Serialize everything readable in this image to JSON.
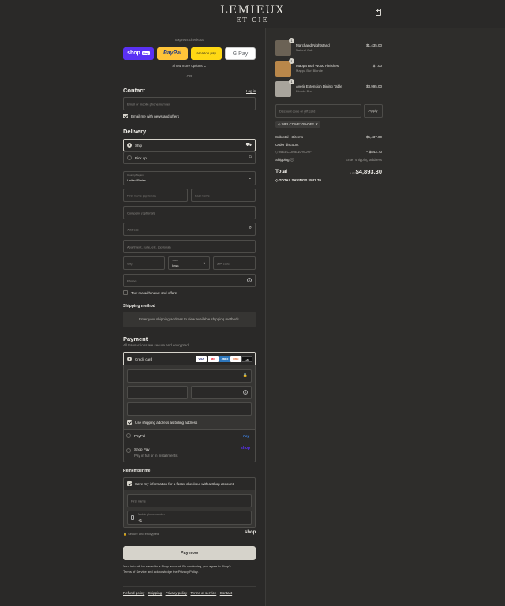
{
  "brand": {
    "line1": "LEMIEUX",
    "line2": "ET CIE"
  },
  "express": {
    "title": "Express checkout",
    "shop_pay": "shop",
    "shop_pay_badge": "Pay",
    "paypal": "PayPal",
    "amazon": "amazon pay",
    "gpay": "G Pay",
    "show_more": "Show more options",
    "or": "OR"
  },
  "contact": {
    "title": "Contact",
    "login": "Log in",
    "email_placeholder": "Email or mobile phone number",
    "news_label": "Email me with news and offers"
  },
  "delivery": {
    "title": "Delivery",
    "ship": "Ship",
    "pickup": "Pick up",
    "country_label": "Country/Region",
    "country_value": "United States",
    "first_name": "First name (optional)",
    "last_name": "Last name",
    "company": "Company (optional)",
    "address": "Address",
    "apartment": "Apartment, suite, etc. (optional)",
    "city": "City",
    "state_label": "State",
    "state_value": "Iowa",
    "zip": "ZIP code",
    "phone": "Phone",
    "text_label": "Text me with news and offers"
  },
  "shipping_method": {
    "title": "Shipping method",
    "message": "Enter your shipping address to view available shipping methods."
  },
  "payment": {
    "title": "Payment",
    "subtitle": "All transactions are secure and encrypted.",
    "credit_card": "Credit card",
    "cards": [
      "VISA",
      "MC",
      "AMEX",
      "DISC",
      "+6"
    ],
    "billing_label": "Use shipping address as billing address",
    "paypal": "PayPal",
    "paypal_logo": "Pay",
    "shop_pay": "Shop Pay",
    "shop_pay_sub": "Pay in full or in installments",
    "shop_pay_logo": "shop"
  },
  "remember": {
    "title": "Remember me",
    "save_label": "Save my information for a faster checkout with a Shop account",
    "first_name": "First name",
    "mobile_label": "Mobile phone number",
    "mobile_value": "+1",
    "secure": "Secure and encrypted",
    "shop_logo": "shop"
  },
  "pay_button": "Pay now",
  "legal": {
    "line1": "Your info will be saved to a Shop account. By continuing, you agree to Shop's",
    "tos": "Terms of Service",
    "and": "and acknowledge the",
    "privacy": "Privacy Policy."
  },
  "footer": [
    "Refund policy",
    "Shipping",
    "Privacy policy",
    "Terms of service",
    "Contact"
  ],
  "items": [
    {
      "qty": "1",
      "name": "Marchand Nightstand",
      "variant": "Natural Oak",
      "price": "$1,435.00",
      "color": "#6b6255"
    },
    {
      "qty": "1",
      "name": "Mappa Burl Wood Finishes",
      "variant": "Mappa Burl Blonde",
      "price": "$7.00",
      "color": "#b9874a"
    },
    {
      "qty": "1",
      "name": "Averir Extension Dining Table",
      "variant": "Blonde Burl",
      "price": "$3,995.00",
      "color": "#a8a49c"
    }
  ],
  "discount": {
    "placeholder": "Discount code or gift card",
    "apply": "Apply",
    "tag": "WELCOME10%OFF"
  },
  "summary": {
    "subtotal_label": "Subtotal · 3 items",
    "subtotal": "$5,437.00",
    "order_discount_label": "Order discount",
    "code": "WELCOME10%OFF",
    "discount": "− $543.70",
    "shipping_label": "Shipping",
    "shipping_value": "Enter shipping address",
    "total_label": "Total",
    "currency": "USD",
    "total": "$4,893.30",
    "savings_label": "TOTAL SAVINGS",
    "savings": "$543.70"
  }
}
